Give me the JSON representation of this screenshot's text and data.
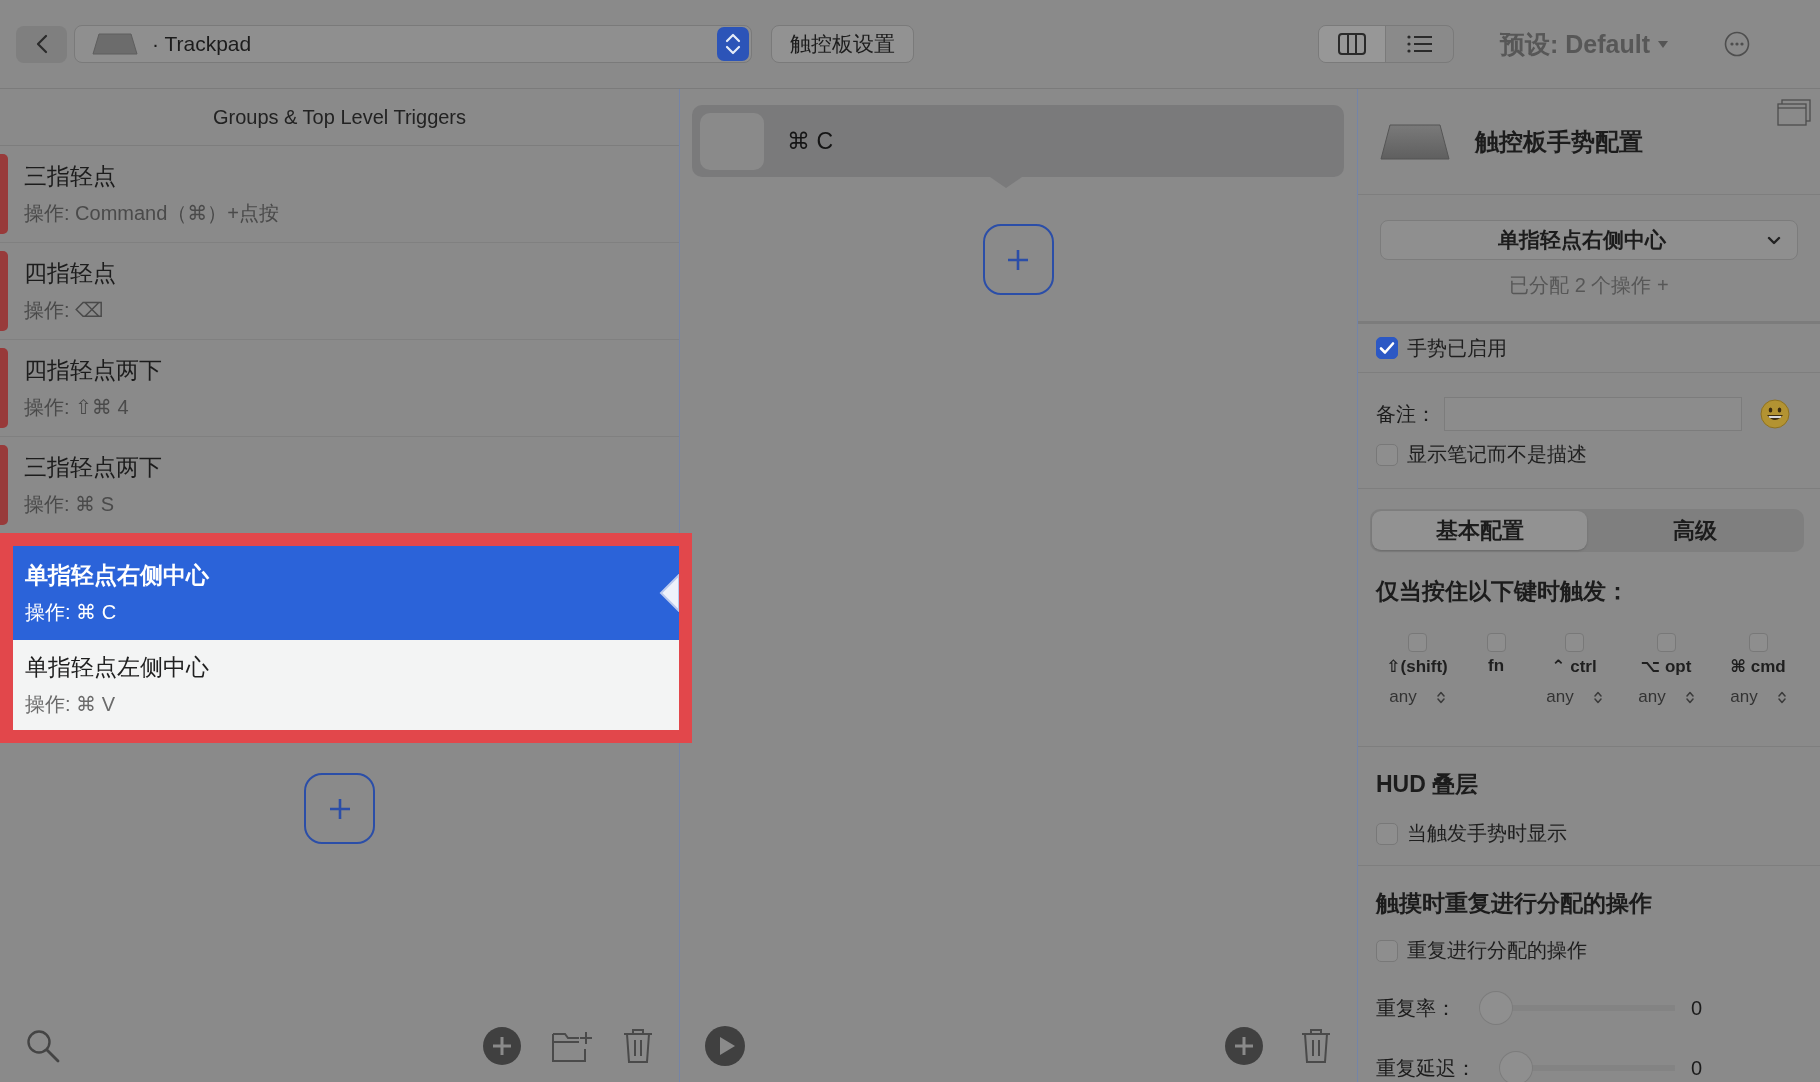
{
  "toolbar": {
    "device": "· Trackpad",
    "settings_button": "触控板设置",
    "view_modes": [
      {
        "kind": "columns",
        "selected": true
      },
      {
        "kind": "list",
        "selected": false
      }
    ],
    "preset": "预设: Default"
  },
  "triggers_panel": {
    "header": "Groups & Top Level Triggers",
    "triggers": [
      {
        "name": "三指轻点",
        "action": "操作: Command（⌘）+点按",
        "color": "#983a3a",
        "selected": false,
        "spotlighted": false
      },
      {
        "name": "四指轻点",
        "action": "操作: ⌫",
        "color": "#983a3a",
        "selected": false,
        "spotlighted": false
      },
      {
        "name": "四指轻点两下",
        "action": "操作: ⇧⌘ 4",
        "color": "#983a3a",
        "selected": false,
        "spotlighted": false
      },
      {
        "name": "三指轻点两下",
        "action": "操作: ⌘ S",
        "color": "#983a3a",
        "selected": false,
        "spotlighted": false
      },
      {
        "name": "单指轻点右侧中心",
        "action": "操作: ⌘ C",
        "selected": true,
        "spotlighted": true
      },
      {
        "name": "单指轻点左侧中心",
        "action": "操作: ⌘ V",
        "selected": false,
        "spotlighted": true
      }
    ]
  },
  "actions_panel": {
    "actions": [
      {
        "shortcut": "⌘ C"
      }
    ]
  },
  "config_panel": {
    "title": "触控板手势配置",
    "gesture_select": "单指轻点右侧中心",
    "assigned_link": "已分配 2 个操作 +",
    "enabled": {
      "label": "手势已启用",
      "checked": true
    },
    "note": {
      "label": "备注："
    },
    "show_note": {
      "label": "显示笔记而不是描述",
      "checked": false
    },
    "tabs": [
      {
        "label": "基本配置",
        "selected": true
      },
      {
        "label": "高级",
        "selected": false
      }
    ],
    "modifiers_heading": "仅当按住以下键时触发：",
    "modifiers": [
      {
        "label": "⇧(shift)",
        "checked": false,
        "mode": "any"
      },
      {
        "label": "fn",
        "checked": false
      },
      {
        "label": "⌃ ctrl",
        "checked": false,
        "mode": "any"
      },
      {
        "label": "⌥ opt",
        "checked": false,
        "mode": "any"
      },
      {
        "label": "⌘ cmd",
        "checked": false,
        "mode": "any"
      }
    ],
    "hud": {
      "heading": "HUD 叠层",
      "checkbox": {
        "label": "当触发手势时显示",
        "checked": false
      }
    },
    "repeat": {
      "heading": "触摸时重复进行分配的操作",
      "checkbox": {
        "label": "重复进行分配的操作",
        "checked": false
      },
      "sliders": [
        {
          "label": "重复率：",
          "level": 0,
          "reading": "0"
        },
        {
          "label": "重复延迟：",
          "level": 0,
          "reading": "0"
        }
      ]
    }
  }
}
